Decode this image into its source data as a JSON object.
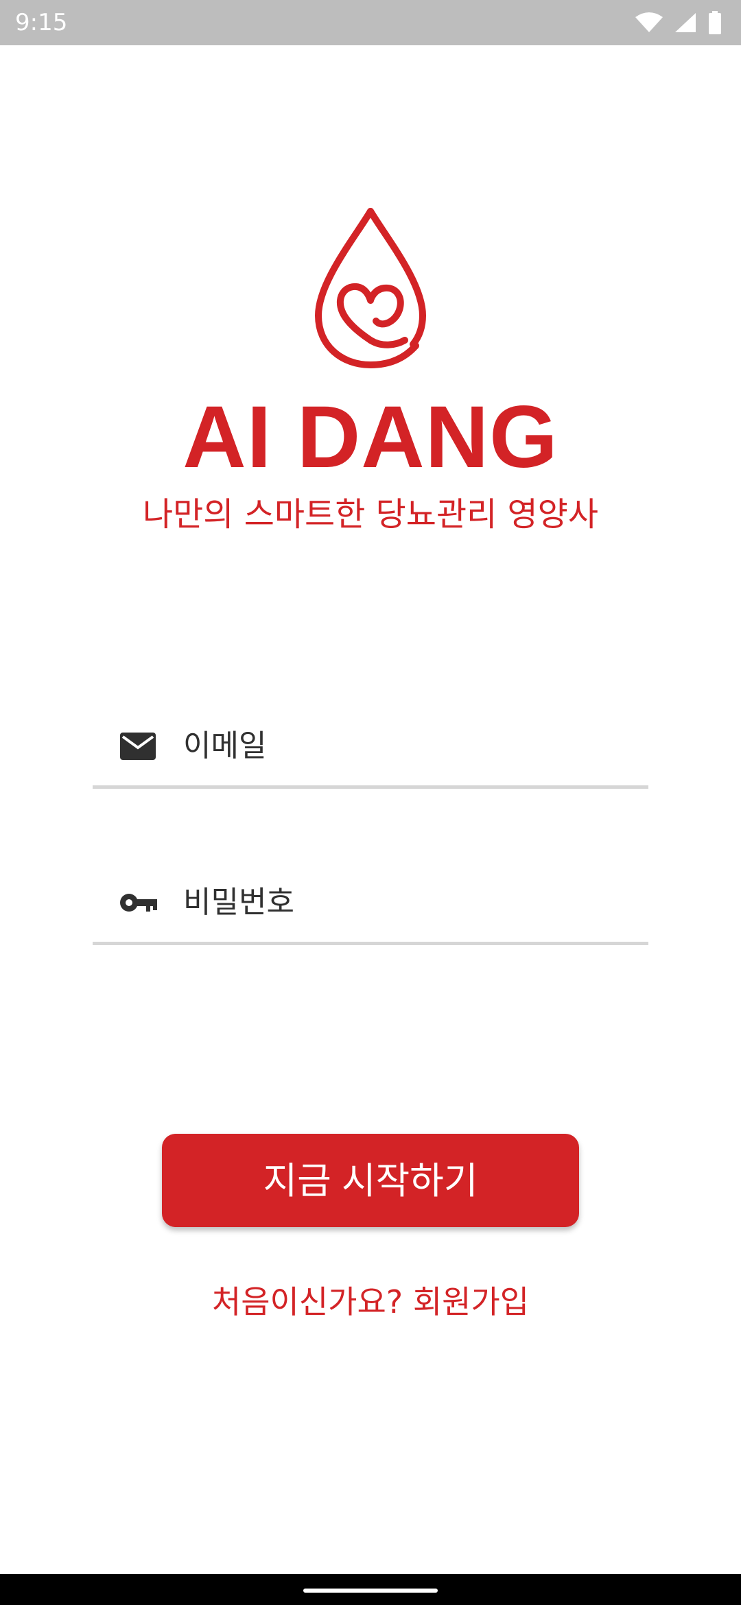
{
  "status_bar": {
    "time": "9:15",
    "icons": [
      "wifi-icon",
      "cell-signal-icon",
      "battery-icon"
    ]
  },
  "branding": {
    "logo_icon": "blood-drop-heart-icon",
    "title": "AI DANG",
    "subtitle": "나만의 스마트한 당뇨관리 영양사",
    "accent_color": "#d32326"
  },
  "form": {
    "email": {
      "icon": "mail-icon",
      "placeholder": "이메일"
    },
    "password": {
      "icon": "key-icon",
      "placeholder": "비밀번호"
    }
  },
  "actions": {
    "start_label": "지금 시작하기",
    "signup_label": "처음이신가요? 회원가입"
  }
}
